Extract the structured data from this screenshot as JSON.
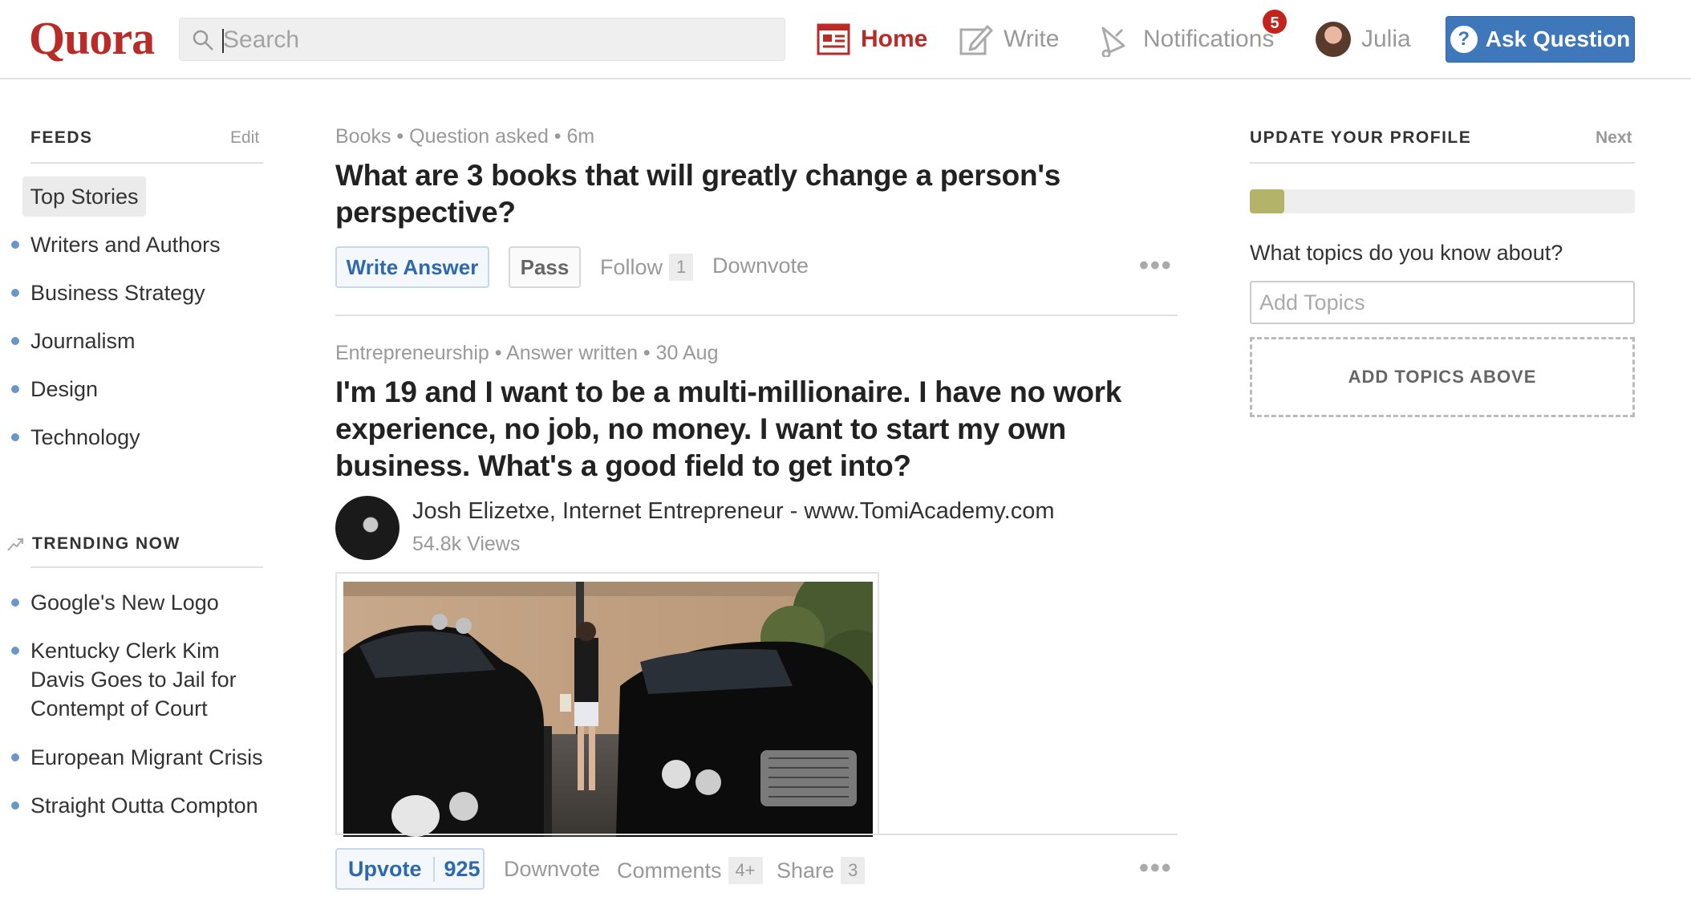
{
  "brand": {
    "logo": "Quora",
    "accent": "#b92b27",
    "blue": "#3e78bb"
  },
  "search": {
    "placeholder": "Search"
  },
  "nav": {
    "home": "Home",
    "write": "Write",
    "notifications": "Notifications",
    "notifications_count": "5",
    "user": "Julia",
    "ask": "Ask Question",
    "ask_icon": "?"
  },
  "feeds": {
    "title": "FEEDS",
    "edit": "Edit",
    "selected": "Top Stories",
    "items": [
      "Writers and Authors",
      "Business Strategy",
      "Journalism",
      "Design",
      "Technology"
    ]
  },
  "trending": {
    "title": "TRENDING NOW",
    "items": [
      "Google's New Logo",
      "Kentucky Clerk Kim Davis Goes to Jail for Contempt of Court",
      "European Migrant Crisis",
      "Straight Outta Compton"
    ]
  },
  "story1": {
    "meta": "Books • Question asked • 6m",
    "title": "What are 3 books that will greatly change a person's perspective?",
    "write_answer": "Write Answer",
    "pass": "Pass",
    "follow": "Follow",
    "follow_count": "1",
    "downvote": "Downvote",
    "more": "•••"
  },
  "story2": {
    "meta": "Entrepreneurship • Answer written • 30 Aug",
    "title": "I'm 19 and I want to be a multi-millionaire. I have no work experience, no job, no money. I want to start my own business. What's a good field to get into?",
    "author": "Josh Elizetxe, Internet Entrepreneur - www.TomiAcademy.com",
    "views": "54.8k Views",
    "upvote": "Upvote",
    "upvote_count": "925",
    "downvote": "Downvote",
    "comments": "Comments",
    "comments_count": "4+",
    "share": "Share",
    "share_count": "3",
    "more": "•••"
  },
  "profile": {
    "title": "UPDATE YOUR PROFILE",
    "next": "Next",
    "progress_fraction": 0.09,
    "question": "What topics do you know about?",
    "input_placeholder": "Add Topics",
    "add_above": "ADD TOPICS ABOVE"
  }
}
